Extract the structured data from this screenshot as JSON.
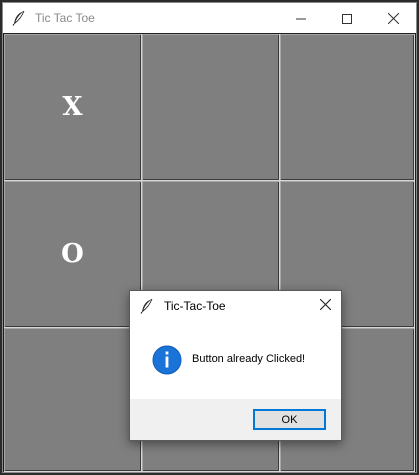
{
  "window": {
    "title": "Tic Tac Toe",
    "controls": [
      "minimize",
      "maximize",
      "close"
    ]
  },
  "board": {
    "cells": [
      {
        "row": 1,
        "col": 1,
        "mark": "X"
      },
      {
        "row": 1,
        "col": 2,
        "mark": ""
      },
      {
        "row": 1,
        "col": 3,
        "mark": ""
      },
      {
        "row": 2,
        "col": 1,
        "mark": "O"
      },
      {
        "row": 2,
        "col": 2,
        "mark": ""
      },
      {
        "row": 2,
        "col": 3,
        "mark": ""
      },
      {
        "row": 3,
        "col": 1,
        "mark": ""
      },
      {
        "row": 3,
        "col": 2,
        "mark": ""
      },
      {
        "row": 3,
        "col": 3,
        "mark": ""
      }
    ],
    "cell_color": "#7f7f7f",
    "mark_color": "#ffffff"
  },
  "dialog": {
    "title": "Tic-Tac-Toe",
    "message": "Button already Clicked!",
    "icon": "info-icon",
    "ok_label": "OK",
    "accent": "#0078d7"
  }
}
